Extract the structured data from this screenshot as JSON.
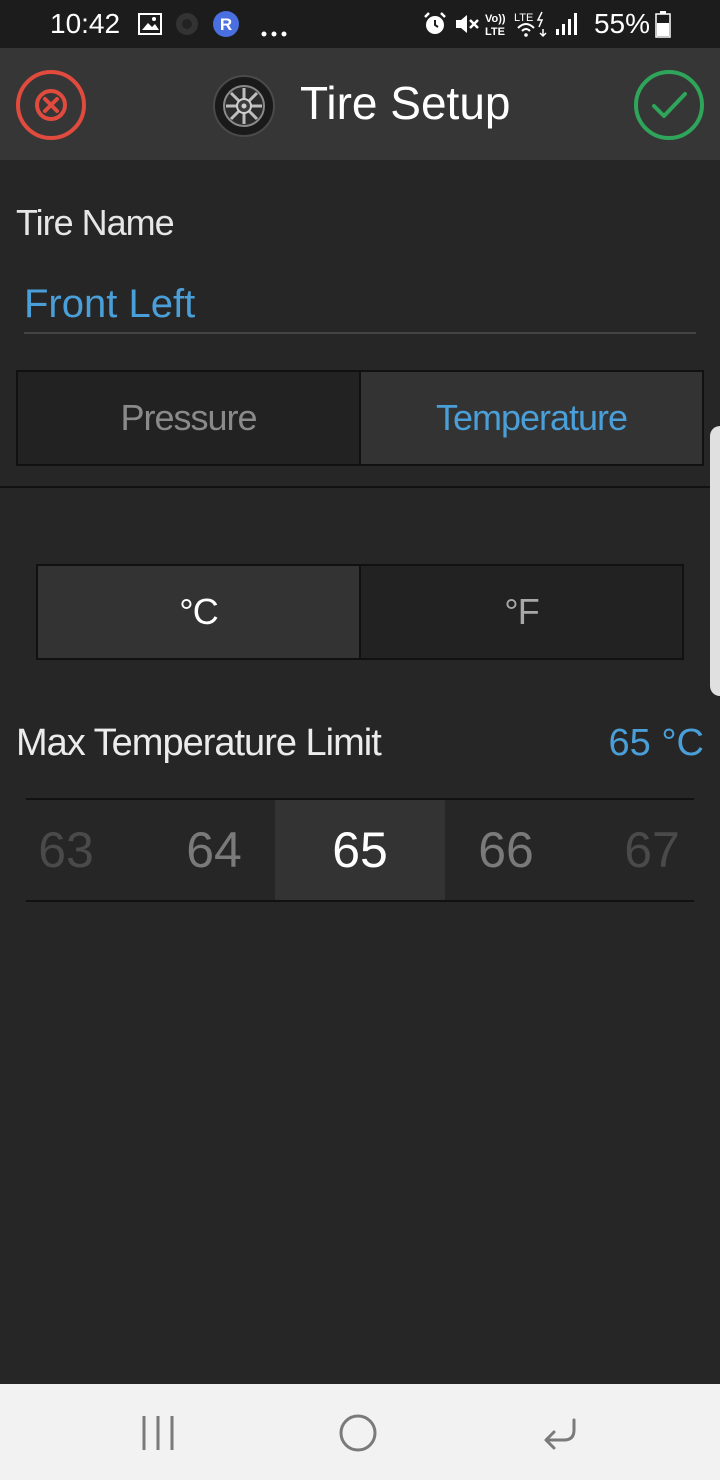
{
  "status_bar": {
    "time": "10:42",
    "battery_percent": "55%",
    "icons": [
      "image-icon",
      "circle-app-icon",
      "r-app-icon",
      "more-dots-icon",
      "alarm-icon",
      "mute-icon",
      "volte-icon",
      "lte-wifi-icon",
      "signal-icon",
      "battery-icon"
    ]
  },
  "app_bar": {
    "title": "Tire Setup",
    "cancel_color": "#e04b3e",
    "confirm_color": "#2ea55a"
  },
  "tire_name": {
    "label": "Tire Name",
    "value": "Front Left"
  },
  "tabs": [
    {
      "label": "Pressure",
      "active": false
    },
    {
      "label": "Temperature",
      "active": true
    }
  ],
  "units": [
    {
      "label": "°C",
      "active": true
    },
    {
      "label": "°F",
      "active": false
    }
  ],
  "max_temperature": {
    "label": "Max Temperature Limit",
    "value": "65 °C"
  },
  "picker": {
    "values": [
      "63",
      "64",
      "65",
      "66",
      "67"
    ],
    "selected": "65"
  },
  "colors": {
    "accent": "#4a9fd8",
    "background": "#262626",
    "app_bar": "#363636"
  }
}
